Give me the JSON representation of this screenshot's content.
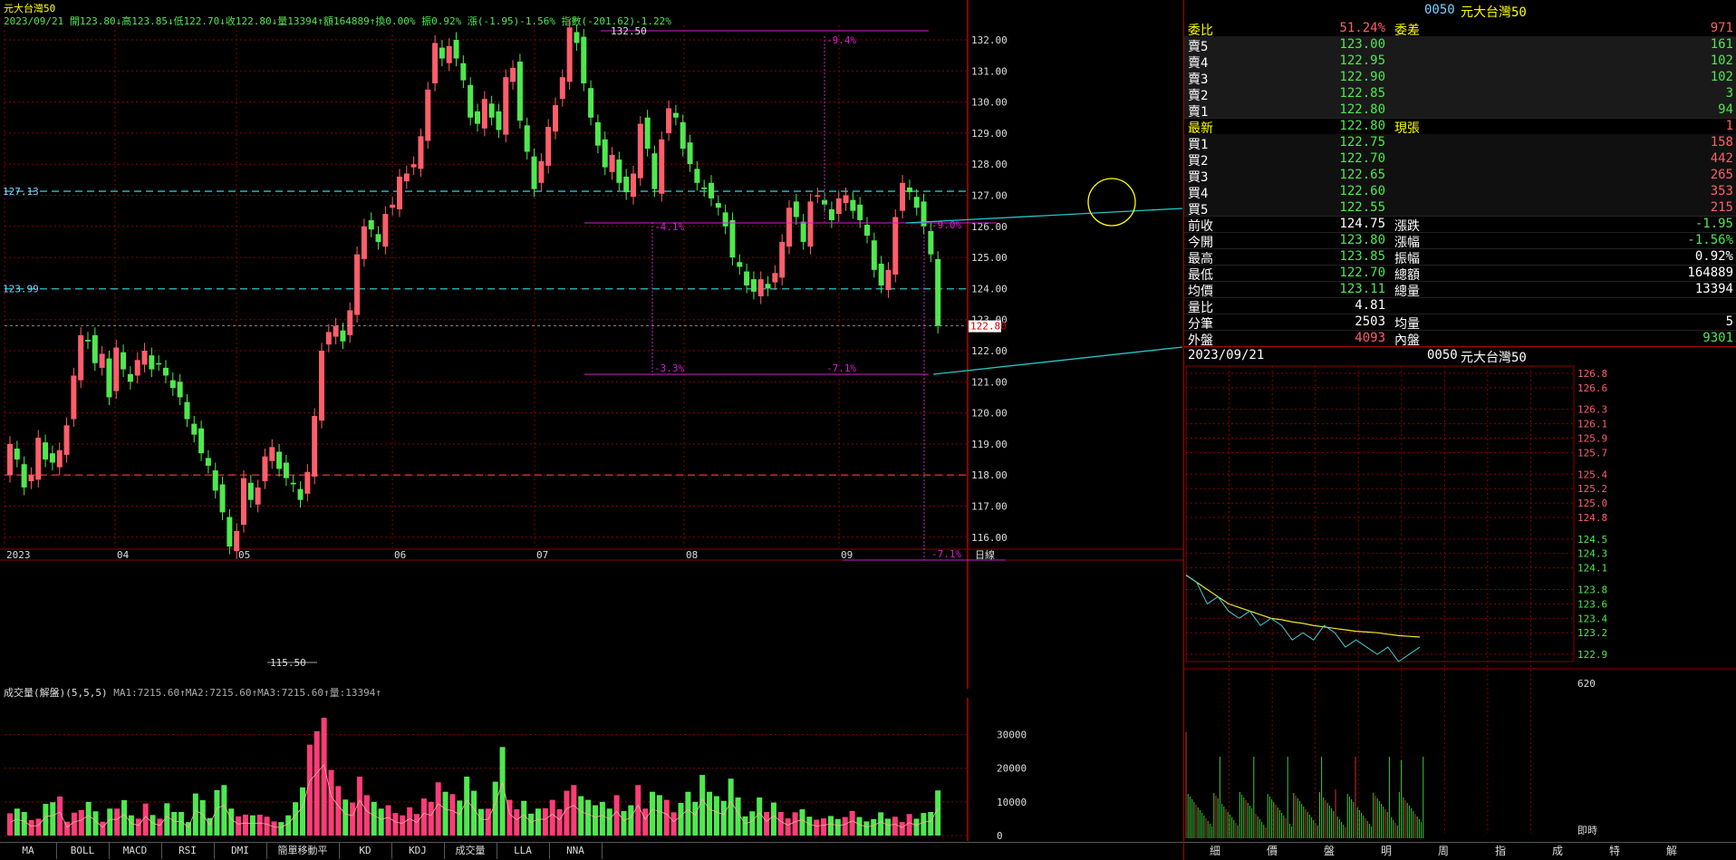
{
  "colors": {
    "up": "#ff5e6b",
    "down": "#4fe84f",
    "grid": "#8b0000",
    "cyan": "#22c8c8",
    "magenta": "#d020d0",
    "yellow": "#ffff00",
    "text": "#dddddd",
    "label_cyan": "#7fd0ff"
  },
  "header": {
    "title": "元大台灣50",
    "ohlc_line": "2023/09/21 開123.80↓高123.85↓低122.70↓收122.80↓量13394↑額164889↑換0.00% 振0.92% 漲(-1.95)-1.56% 指數(-201.62)-1.22%"
  },
  "price_panel": {
    "y_labels": [
      "132.00",
      "131.00",
      "130.00",
      "129.00",
      "128.00",
      "127.00",
      "126.00",
      "125.00",
      "124.00",
      "123.00",
      "122.00",
      "121.00",
      "120.00",
      "119.00",
      "118.00",
      "117.00",
      "116.00"
    ],
    "x_labels": [
      "2023",
      "04",
      "05",
      "06",
      "07",
      "08",
      "09",
      "日線"
    ],
    "hline_labels": [
      "127.13",
      "123.99"
    ],
    "current_price_tag": "122.80",
    "high_label": "132.50",
    "low_label": "115.50",
    "ann_labels": [
      "-9.4%",
      "-4.1%",
      "-9.0%",
      "-3.3%",
      "-7.1%",
      "-7.1%"
    ]
  },
  "chart_data": [
    {
      "type": "candlestick",
      "title": "元大台灣50 日線",
      "xlabel": "",
      "ylabel": "",
      "ylim": [
        115.3,
        132.6
      ],
      "x_ticks": [
        "2023",
        "04",
        "05",
        "06",
        "07",
        "08",
        "09"
      ],
      "high": 132.5,
      "low": 115.5,
      "horizontal_lines": [
        127.13,
        123.99,
        118.0
      ],
      "series": [
        {
          "name": "close",
          "values": [
            119.0,
            118.5,
            117.6,
            118.0,
            119.2,
            118.5,
            118.4,
            118.8,
            119.6,
            121.2,
            122.5,
            122.3,
            121.6,
            121.9,
            120.5,
            122.1,
            121.4,
            121.0,
            121.7,
            122.0,
            121.4,
            121.6,
            121.2,
            120.8,
            120.5,
            119.8,
            119.3,
            118.7,
            118.3,
            117.5,
            116.8,
            115.7,
            116.2,
            117.9,
            117.2,
            117.6,
            118.6,
            118.9,
            118.2,
            117.9,
            117.7,
            117.2,
            118.1,
            119.9,
            122.0,
            122.6,
            122.8,
            122.3,
            123.3,
            125.1,
            126.0,
            125.9,
            125.5,
            126.4,
            126.7,
            127.6,
            127.7,
            128.0,
            128.9,
            130.4,
            131.9,
            131.4,
            131.8,
            131.4,
            130.7,
            129.5,
            129.3,
            130.1,
            129.5,
            129.1,
            130.8,
            131.1,
            129.4,
            128.4,
            127.2,
            128.1,
            129.2,
            129.9,
            130.8,
            132.4,
            131.9,
            130.6,
            129.5,
            128.6,
            127.9,
            128.3,
            127.4,
            127.1,
            127.7,
            129.3,
            128.5,
            127.2,
            128.8,
            129.8,
            129.5,
            128.5,
            128.0,
            127.4,
            127.2,
            126.9,
            126.6,
            126.0,
            125.0,
            124.7,
            124.1,
            123.9,
            124.3,
            124.0,
            124.5,
            125.5,
            126.6,
            126.3,
            125.5,
            126.8,
            127.0,
            126.7,
            126.2,
            126.9,
            127.0,
            126.5,
            126.2,
            125.7,
            124.6,
            124.1,
            124.6,
            126.3,
            127.4,
            127.1,
            126.6,
            126.0,
            125.1,
            122.8
          ]
        }
      ]
    },
    {
      "type": "bar",
      "title": "成交量(解盤)(5,5,5)",
      "ylim": [
        0,
        36000
      ],
      "y_ticks": [
        30000,
        20000,
        10000,
        0
      ],
      "series": [
        {
          "name": "成交量",
          "values": [
            6600,
            8000,
            7000,
            4600,
            5000,
            9400,
            9900,
            11600,
            4100,
            6800,
            7600,
            10000,
            7200,
            4100,
            8000,
            8000,
            10500,
            6000,
            5000,
            9500,
            6100,
            5000,
            9600,
            7000,
            7000,
            4000,
            12500,
            10500,
            5200,
            13500,
            15000,
            8000,
            5700,
            6200,
            6000,
            6200,
            5600,
            4200,
            4000,
            6000,
            9900,
            14300,
            27000,
            31000,
            35000,
            19500,
            14700,
            10700,
            9800,
            17500,
            12000,
            10000,
            8000,
            9000,
            6700,
            6000,
            8400,
            6400,
            11000,
            10000,
            15800,
            13000,
            12300,
            10400,
            17500,
            13300,
            7900,
            8000,
            16000,
            26300,
            10600,
            7800,
            10300,
            6500,
            8000,
            8100,
            10600,
            7800,
            13300,
            15000,
            11700,
            10600,
            9000,
            10000,
            8000,
            12000,
            7300,
            9000,
            15000,
            8000,
            13000,
            12000,
            10600,
            6900,
            9700,
            13000,
            10000,
            18000,
            13000,
            11700,
            10300,
            16900,
            11300,
            5700,
            7200,
            11300,
            7000,
            9800,
            7000,
            5100,
            6900,
            7800,
            5600,
            4700,
            5100,
            5800,
            4900,
            5500,
            7300,
            5500,
            4200,
            4900,
            6900,
            5000,
            5600,
            4000,
            6400,
            5000,
            6700,
            7000,
            13394
          ]
        }
      ],
      "ma_label": "MA1:7215.60↑MA2:7215.60↑MA3:7215.60↑量:13394↑"
    },
    {
      "type": "line",
      "title": "0050 元大台灣50 分時",
      "ylim": [
        122.8,
        126.9
      ],
      "y_ticks": [
        "126.8",
        "126.6",
        "126.3",
        "126.1",
        "125.9",
        "125.7",
        "125.4",
        "125.2",
        "125.0",
        "124.8",
        "124.5",
        "124.3",
        "124.1",
        "123.8",
        "123.6",
        "123.4",
        "123.2",
        "122.9"
      ],
      "series": [
        {
          "name": "price",
          "values": [
            124.0,
            123.9,
            123.6,
            123.7,
            123.5,
            123.4,
            123.5,
            123.3,
            123.4,
            123.3,
            123.1,
            123.2,
            123.1,
            123.3,
            123.2,
            123.0,
            123.1,
            123.0,
            122.9,
            123.0,
            122.8,
            122.9,
            123.0
          ]
        },
        {
          "name": "avg",
          "values": [
            124.0,
            123.9,
            123.8,
            123.7,
            123.6,
            123.55,
            123.5,
            123.45,
            123.4,
            123.38,
            123.35,
            123.33,
            123.3,
            123.28,
            123.26,
            123.24,
            123.22,
            123.21,
            123.2,
            123.18,
            123.16,
            123.15,
            123.14
          ]
        }
      ],
      "volume_label": "620",
      "time_label": "即時"
    }
  ],
  "quote": {
    "header_code": "0050",
    "header_name": "元大台灣50",
    "rows": [
      {
        "l1": "委比",
        "v1": "51.24%",
        "l2": "委差",
        "v2": "971",
        "c1": "#ff5e6b",
        "c2": "#ff5e6b"
      },
      {
        "l1": "賣5",
        "v1": "123.00",
        "l2": "",
        "v2": "161",
        "c1": "#4fe84f",
        "c2": "#4fe84f"
      },
      {
        "l1": "賣4",
        "v1": "122.95",
        "l2": "",
        "v2": "102",
        "c1": "#4fe84f",
        "c2": "#4fe84f"
      },
      {
        "l1": "賣3",
        "v1": "122.90",
        "l2": "",
        "v2": "102",
        "c1": "#4fe84f",
        "c2": "#4fe84f"
      },
      {
        "l1": "賣2",
        "v1": "122.85",
        "l2": "",
        "v2": "3",
        "c1": "#4fe84f",
        "c2": "#4fe84f"
      },
      {
        "l1": "賣1",
        "v1": "122.80",
        "l2": "",
        "v2": "94",
        "c1": "#4fe84f",
        "c2": "#4fe84f"
      },
      {
        "l1": "最新",
        "v1": "122.80",
        "l2": "現張",
        "v2": "1",
        "c1": "#4fe84f",
        "c2": "#ff5e6b"
      },
      {
        "l1": "買1",
        "v1": "122.75",
        "l2": "",
        "v2": "158",
        "c1": "#4fe84f",
        "c2": "#ff5e6b"
      },
      {
        "l1": "買2",
        "v1": "122.70",
        "l2": "",
        "v2": "442",
        "c1": "#4fe84f",
        "c2": "#ff5e6b"
      },
      {
        "l1": "買3",
        "v1": "122.65",
        "l2": "",
        "v2": "265",
        "c1": "#4fe84f",
        "c2": "#ff5e6b"
      },
      {
        "l1": "買4",
        "v1": "122.60",
        "l2": "",
        "v2": "353",
        "c1": "#4fe84f",
        "c2": "#ff5e6b"
      },
      {
        "l1": "買5",
        "v1": "122.55",
        "l2": "",
        "v2": "215",
        "c1": "#4fe84f",
        "c2": "#ff5e6b"
      },
      {
        "l1": "前收",
        "v1": "124.75",
        "l2": "漲跌",
        "v2": "-1.95",
        "c1": "#ffffff",
        "c2": "#4fe84f"
      },
      {
        "l1": "今開",
        "v1": "123.80",
        "l2": "漲幅",
        "v2": "-1.56%",
        "c1": "#4fe84f",
        "c2": "#4fe84f"
      },
      {
        "l1": "最高",
        "v1": "123.85",
        "l2": "振幅",
        "v2": "0.92%",
        "c1": "#4fe84f",
        "c2": "#ffffff"
      },
      {
        "l1": "最低",
        "v1": "122.70",
        "l2": "總額",
        "v2": "164889",
        "c1": "#4fe84f",
        "c2": "#ffffff"
      },
      {
        "l1": "均價",
        "v1": "123.11",
        "l2": "總量",
        "v2": "13394",
        "c1": "#4fe84f",
        "c2": "#ffffff"
      },
      {
        "l1": "量比",
        "v1": "4.81",
        "l2": "",
        "v2": "",
        "c1": "#ffffff",
        "c2": "#ffffff"
      },
      {
        "l1": "分筆",
        "v1": "2503",
        "l2": "均量",
        "v2": "5",
        "c1": "#ffffff",
        "c2": "#ffffff"
      },
      {
        "l1": "外盤",
        "v1": "4093",
        "l2": "內盤",
        "v2": "9301",
        "c1": "#ff5e6b",
        "c2": "#4fe84f"
      }
    ],
    "footer_date": "2023/09/21",
    "footer_code": "0050",
    "footer_name": "元大台灣50"
  },
  "indicator_tabs": [
    "MA",
    "BOLL",
    "MACD",
    "RSI",
    "DMI",
    "簡單移動平",
    "KD",
    "KDJ",
    "成交量",
    "LLA",
    "NNA"
  ],
  "right_tabs": [
    "細",
    "價",
    "盤",
    "明",
    "周",
    "指",
    "成",
    "特",
    "解"
  ]
}
